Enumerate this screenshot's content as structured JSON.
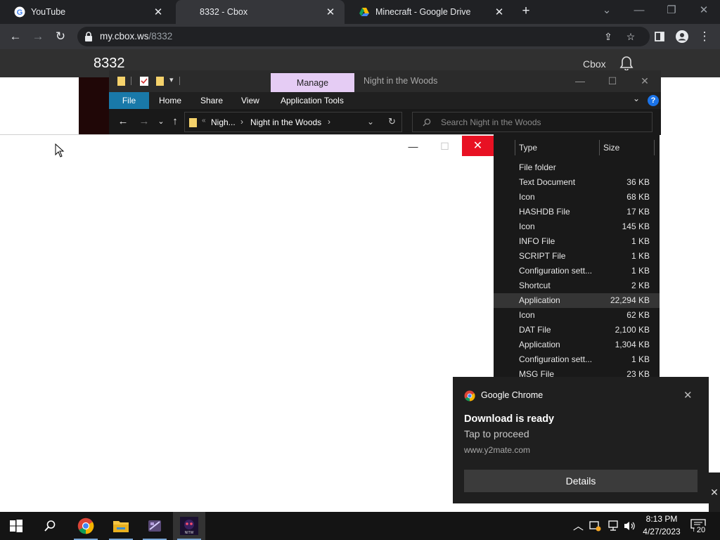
{
  "browser": {
    "tabs": [
      {
        "title": "YouTube",
        "icon": "google-g-icon"
      },
      {
        "title": "8332 - Cbox",
        "icon": "none"
      },
      {
        "title": "Minecraft - Google Drive",
        "icon": "google-drive-icon"
      }
    ],
    "url_host": "my.cbox.ws",
    "url_path": "/8332"
  },
  "cbox": {
    "title": "8332",
    "brand": "Cbox"
  },
  "explorer": {
    "manage_label": "Manage",
    "window_title": "Night in the Woods",
    "ribbon": {
      "file": "File",
      "home": "Home",
      "share": "Share",
      "view": "View",
      "app_tools": "Application Tools"
    },
    "breadcrumb": {
      "overflow": "«",
      "parent": "Nigh...",
      "current": "Night in the Woods"
    },
    "search_placeholder": "Search Night in the Woods",
    "columns": {
      "type": "Type",
      "size": "Size"
    },
    "rows": [
      {
        "type": "File folder",
        "size": ""
      },
      {
        "type": "Text Document",
        "size": "36 KB"
      },
      {
        "type": "Icon",
        "size": "68 KB"
      },
      {
        "type": "HASHDB File",
        "size": "17 KB"
      },
      {
        "type": "Icon",
        "size": "145 KB"
      },
      {
        "type": "INFO File",
        "size": "1 KB"
      },
      {
        "type": "SCRIPT File",
        "size": "1 KB"
      },
      {
        "type": "Configuration sett...",
        "size": "1 KB"
      },
      {
        "type": "Shortcut",
        "size": "2 KB"
      },
      {
        "type": "Application",
        "size": "22,294 KB",
        "selected": true
      },
      {
        "type": "Icon",
        "size": "62 KB"
      },
      {
        "type": "DAT File",
        "size": "2,100 KB"
      },
      {
        "type": "Application",
        "size": "1,304 KB"
      },
      {
        "type": "Configuration sett...",
        "size": "1 KB"
      },
      {
        "type": "MSG File",
        "size": "23 KB"
      }
    ]
  },
  "notification": {
    "app": "Google Chrome",
    "title": "Download is ready",
    "body": "Tap to proceed",
    "source": "www.y2mate.com",
    "button": "Details"
  },
  "taskbar": {
    "time": "8:13 PM",
    "date": "4/27/2023",
    "notification_count": "20",
    "pinned": [
      "windows-start-icon",
      "search-icon",
      "chrome-icon",
      "file-explorer-icon",
      "video-editor-icon",
      "nitw-game-icon"
    ]
  },
  "colors": {
    "chrome_dark": "#202124",
    "explorer_file_tab": "#1979a9",
    "manage_tab": "#e5ccf4",
    "close_red": "#e81123"
  }
}
